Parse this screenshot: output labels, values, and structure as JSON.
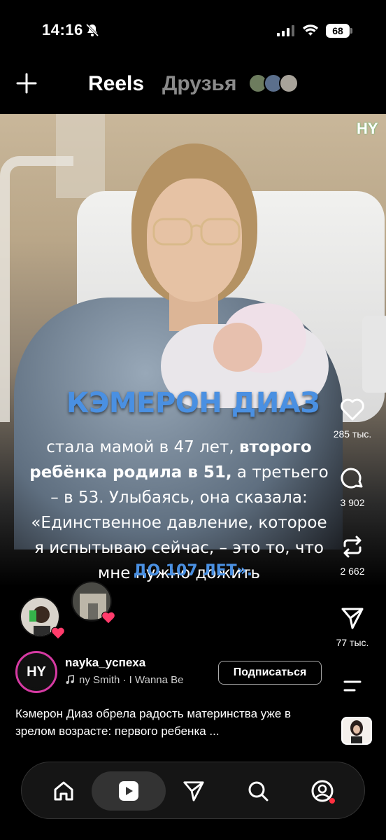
{
  "status_bar": {
    "time": "14:16",
    "battery": "68"
  },
  "header": {
    "tab_reels": "Reels",
    "tab_friends": "Друзья"
  },
  "post": {
    "channel_logo": "HY",
    "headline": "КЭМЕРОН ДИАЗ",
    "caption_part1": "стала мамой в 47 лет, ",
    "caption_bold1": "второго ребёнка родила в 51,",
    "caption_part2": " а третьего – в 53. Улыбаясь, она сказала: «Единственное давление, которое я испытываю сейчас, – это то, что мне нужно дожить",
    "caption_accent": "ДО 107 ЛЕТ».",
    "author": "nayka_ycпexa",
    "music": "ny Smith · I Wanna Be",
    "follow_label": "Подписаться",
    "description": "Кэмерон Диаз обрела радость материнства уже в зрелом возрасте: первого ребенка ...",
    "author_avatar_text": "HY"
  },
  "actions": {
    "likes": "285 тыс.",
    "comments": "3 902",
    "reposts": "2 662",
    "shares": "77 тыс."
  },
  "colors": {
    "accent_blue": "#4a90e2",
    "heart_badge": "#ff3b6b",
    "notification_dot": "#ff3040"
  },
  "nav": [
    "home-icon",
    "reels-icon",
    "direct-icon",
    "search-icon",
    "profile-icon"
  ]
}
